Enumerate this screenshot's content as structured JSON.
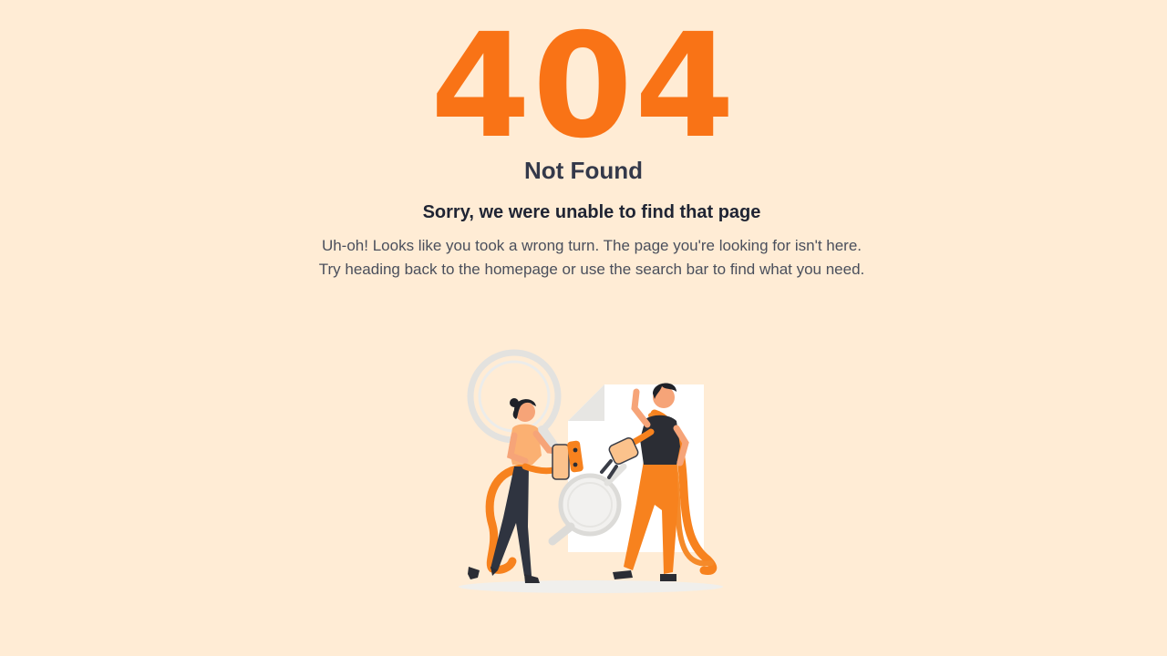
{
  "error": {
    "code": "404",
    "title": "Not Found",
    "subtitle": "Sorry, we were unable to find that page",
    "description": "Uh-oh! Looks like you took a wrong turn. The page you're looking for isn't here. Try heading back to the homepage or use the search bar to find what you need."
  },
  "illustration": {
    "name": "unplugged-cable-illustration"
  },
  "colors": {
    "background": "#ffecd5",
    "accent": "#f97316",
    "heading": "#34394a",
    "text": "#4a4f5c"
  }
}
